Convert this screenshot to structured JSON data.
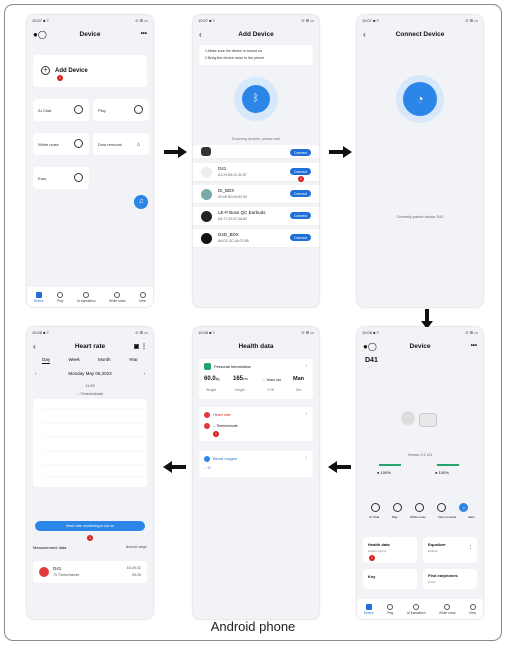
{
  "caption": "Android phone",
  "s1": {
    "title": "Device",
    "add_device": "Add Device",
    "tiles": [
      "AI Chat",
      "Play",
      "White noise",
      "Dust removal",
      "Ears"
    ],
    "nav": [
      "Device",
      "Play",
      "AI translation",
      "White noise",
      "Mine"
    ],
    "step": "1"
  },
  "s2": {
    "title": "Add Device",
    "instr1": "1.Make sure the device is turned on",
    "instr2": "2.Bring the device close to the phone",
    "scanning": "Scanning devices, please wait",
    "devices": [
      {
        "name": "D41",
        "mac": "A1:20:B5:11:32:87"
      },
      {
        "name": "DI_BDX",
        "mac": "00:0E:B0:00:62:09"
      },
      {
        "name": "LE-P Bose QC Earbuds",
        "mac": "A4:77:20:37:3A:82"
      },
      {
        "name": "D4D_BDX",
        "mac": "8A:DC:3C:44:07:B5"
      }
    ],
    "connect": "Connect",
    "step": "2"
  },
  "s3": {
    "title": "Connect Device",
    "status": "Currently paired device D41"
  },
  "s4": {
    "title": "Device",
    "device_name": "D41",
    "version": "Version 0.3.124",
    "battery_left": "100%",
    "battery_right": "100%",
    "tiles": [
      "AI Chat",
      "Play",
      "White noise",
      "Dust removal",
      "Ears"
    ],
    "health_title": "Health data",
    "health_sub": "Health testing",
    "eq_title": "Equalizer",
    "eq_sub": "Default",
    "key_title": "Key",
    "find_title": "Find earphones",
    "find_sub": "Order",
    "nav": [
      "Device",
      "Play",
      "AI translation",
      "White noise",
      "Mine"
    ],
    "step": "1"
  },
  "s5": {
    "title": "Health data",
    "personal": "Personal Information",
    "weight": "60.0",
    "weight_unit": "kg",
    "height": "165",
    "height_unit": "cm",
    "age": "-- Years old",
    "gender": "Man",
    "lbl_weight": "Weight",
    "lbl_height": "Height",
    "lbl_age": "YOB",
    "lbl_gender": "Sex",
    "heart_rate": "Heart rate",
    "hr_value": "-- Times/minute",
    "blood_oxygen": "Blood oxygen",
    "bo_value": "-- %",
    "step": "1"
  },
  "s6": {
    "title": "Heart rate",
    "tabs": [
      "Day",
      "Week",
      "Month",
      "Year"
    ],
    "date": "Monday May 06,2023",
    "time": "11:59",
    "unit": "-- Times/minute",
    "button": "Heart rate monitoring is not on",
    "measurement": "Measurement data",
    "normal": "Normal range",
    "rec_name": "D41",
    "rec_value": "75 Times/minute",
    "rec_date": "16-09-02",
    "rec_time": "09:26",
    "step": "1"
  }
}
